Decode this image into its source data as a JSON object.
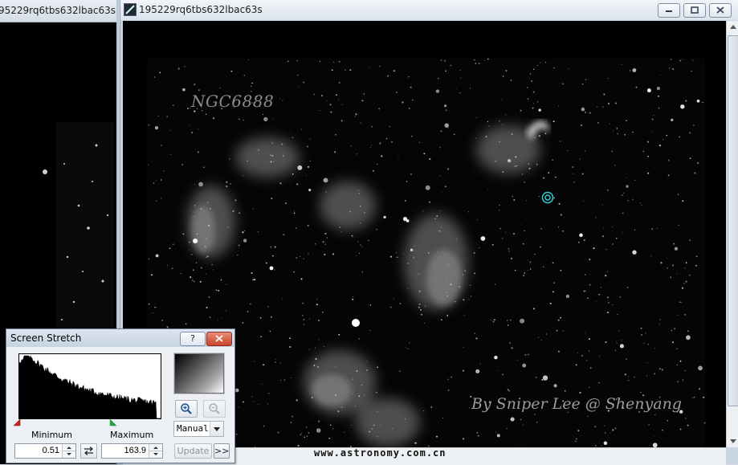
{
  "windows": {
    "left_window": {
      "title": "95229rq6tbs632lbac63s"
    },
    "main_window": {
      "title": "195229rq6tbs632lbac63s",
      "app_icon": "image-document-icon"
    }
  },
  "image_overlays": {
    "object_label": "NGC6888",
    "credit": "By Sniper Lee @ Shenyang",
    "website": "www.astronomy.com.cn"
  },
  "screen_stretch": {
    "title": "Screen Stretch",
    "help_label": "?",
    "minimum_label": "Minimum",
    "maximum_label": "Maximum",
    "minimum_value": "0.51",
    "maximum_value": "163.9",
    "mode": "Manual",
    "update_label": "Update",
    "more_label": ">>"
  },
  "colors": {
    "sky_background": "#000000",
    "marker": "#2fd0d8",
    "min_slider": "#c8281e",
    "max_slider": "#2e9e3c"
  }
}
